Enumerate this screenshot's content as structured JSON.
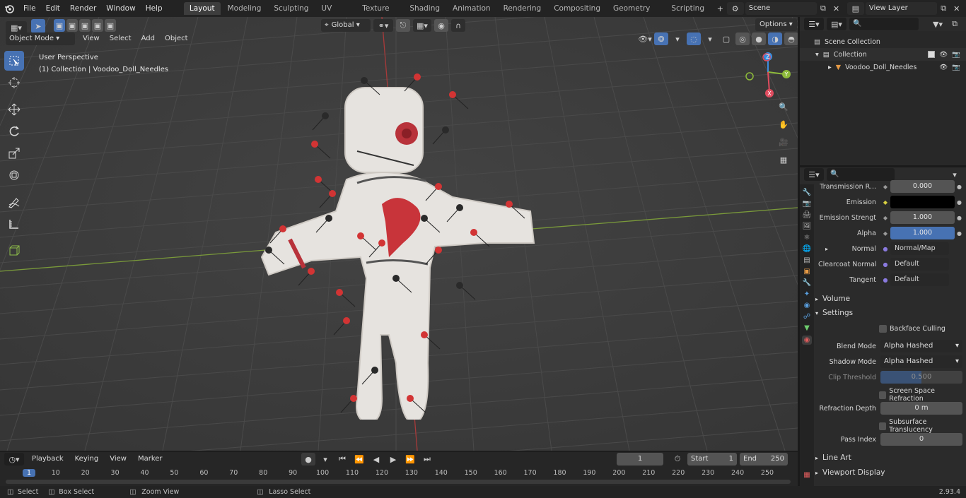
{
  "topbar": {
    "menus": [
      "File",
      "Edit",
      "Render",
      "Window",
      "Help"
    ],
    "workspaces": [
      "Layout",
      "Modeling",
      "Sculpting",
      "UV Editing",
      "Texture Paint",
      "Shading",
      "Animation",
      "Rendering",
      "Compositing",
      "Geometry Nodes",
      "Scripting"
    ],
    "active_workspace": "Layout",
    "add_tab": "+",
    "scene": "Scene",
    "view_layer": "View Layer"
  },
  "viewport": {
    "mode": "Object Mode",
    "menus": [
      "View",
      "Select",
      "Add",
      "Object"
    ],
    "orientation": "Global",
    "options": "Options",
    "perspective": "User Perspective",
    "collection_info": "(1) Collection | Voodoo_Doll_Needles",
    "gizmo": {
      "z": "Z",
      "y": "Y",
      "x": "X"
    }
  },
  "outliner": {
    "scene_collection": "Scene Collection",
    "collection": "Collection",
    "object": "Voodoo_Doll_Needles"
  },
  "properties": {
    "rows": [
      {
        "label": "Transmission R...",
        "value": "0.000",
        "kind": "num"
      },
      {
        "label": "Emission",
        "value": "",
        "kind": "color"
      },
      {
        "label": "Emission Strengt",
        "value": "1.000",
        "kind": "num"
      },
      {
        "label": "Alpha",
        "value": "1.000",
        "kind": "active"
      },
      {
        "label": "Normal",
        "value": "Normal/Map",
        "kind": "link"
      },
      {
        "label": "Clearcoat Normal",
        "value": "Default",
        "kind": "link"
      },
      {
        "label": "Tangent",
        "value": "Default",
        "kind": "link"
      }
    ],
    "volume": "Volume",
    "settings": "Settings",
    "backface_culling": "Backface Culling",
    "blend_mode_label": "Blend Mode",
    "blend_mode": "Alpha Hashed",
    "shadow_mode_label": "Shadow Mode",
    "shadow_mode": "Alpha Hashed",
    "clip_threshold_label": "Clip Threshold",
    "clip_threshold": "0.500",
    "ssr": "Screen Space Refraction",
    "refraction_depth_label": "Refraction Depth",
    "refraction_depth": "0 m",
    "subsurface": "Subsurface Translucency",
    "pass_index_label": "Pass Index",
    "pass_index": "0",
    "line_art": "Line Art",
    "viewport_display": "Viewport Display"
  },
  "timeline": {
    "menus": [
      "Playback",
      "Keying",
      "View",
      "Marker"
    ],
    "current_frame": "1",
    "start_label": "Start",
    "start": "1",
    "end_label": "End",
    "end": "250",
    "ticks": [
      "1",
      "10",
      "20",
      "30",
      "40",
      "50",
      "60",
      "70",
      "80",
      "90",
      "100",
      "110",
      "120",
      "130",
      "140",
      "150",
      "160",
      "170",
      "180",
      "190",
      "200",
      "210",
      "220",
      "230",
      "240",
      "250"
    ]
  },
  "status": {
    "select": "Select",
    "box_select": "Box Select",
    "zoom_view": "Zoom View",
    "lasso_select": "Lasso Select",
    "version": "2.93.4"
  },
  "colors": {
    "accent": "#4772b3",
    "x_axis": "#e04c5f",
    "y_axis": "#8dba3a",
    "z_axis": "#3b8ee0",
    "viewport_bg": "#3d3d3d"
  }
}
